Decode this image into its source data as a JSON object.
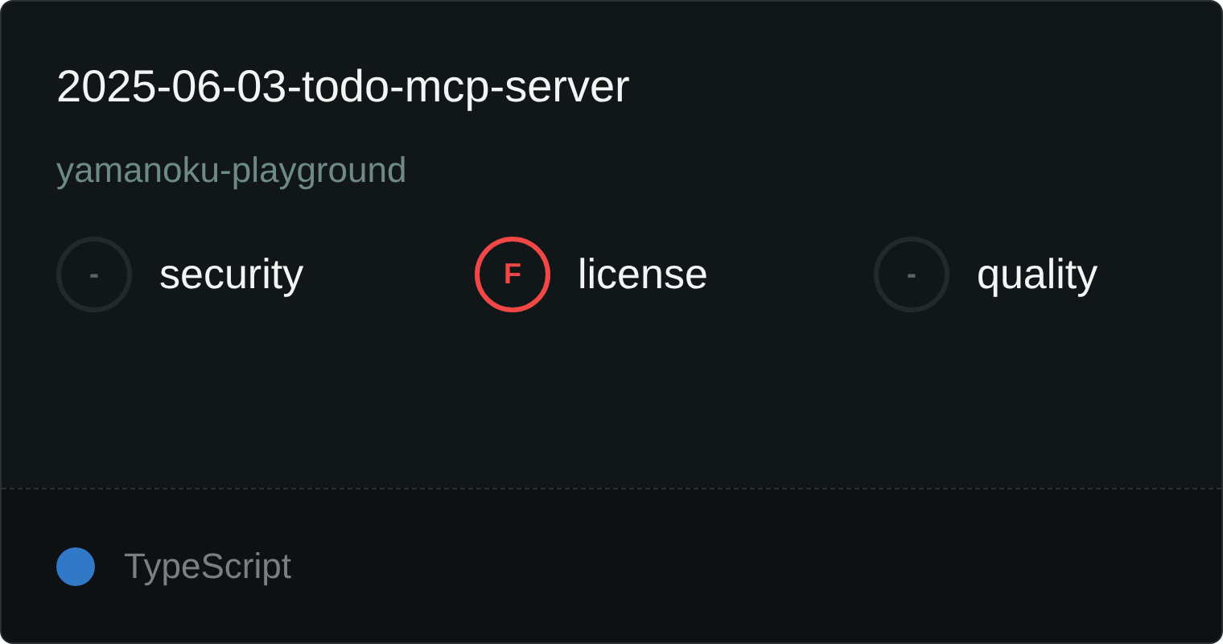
{
  "title": "2025-06-03-todo-mcp-server",
  "owner": "yamanoku-playground",
  "scores": [
    {
      "grade": "-",
      "label": "security",
      "color": "#22282b"
    },
    {
      "grade": "F",
      "label": "license",
      "color": "#f24747"
    },
    {
      "grade": "-",
      "label": "quality",
      "color": "#22282b"
    }
  ],
  "language": {
    "name": "TypeScript",
    "color": "#3178c6"
  }
}
